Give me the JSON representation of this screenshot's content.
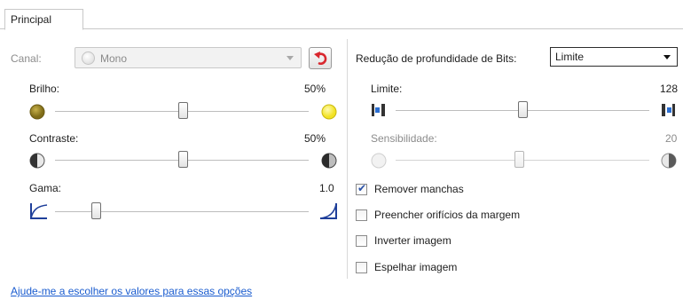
{
  "tab": {
    "label": "Principal"
  },
  "left": {
    "channel": {
      "label": "Canal:",
      "value": "Mono"
    },
    "brightness": {
      "label": "Brilho:",
      "value_text": "50%",
      "position": 0.5
    },
    "contrast": {
      "label": "Contraste:",
      "value_text": "50%",
      "position": 0.5
    },
    "gamma": {
      "label": "Gama:",
      "value_text": "1.0",
      "position": 0.18
    }
  },
  "right": {
    "bit_depth": {
      "label": "Redução de profundidade de Bits:",
      "value": "Limite"
    },
    "threshold": {
      "label": "Limite:",
      "value_text": "128",
      "position": 0.5
    },
    "sensitivity": {
      "label": "Sensibilidade:",
      "value_text": "20",
      "position": 0.5
    },
    "options": [
      {
        "label": "Remover manchas",
        "checked": true
      },
      {
        "label": "Preencher orifícios da margem",
        "checked": false
      },
      {
        "label": "Inverter imagem",
        "checked": false
      },
      {
        "label": "Espelhar imagem",
        "checked": false
      }
    ]
  },
  "help_link": "Ajude-me a escolher os valores para essas opções",
  "colors": {
    "link": "#1a5ccf",
    "reset_arrow": "#d9272e",
    "checkmark": "#2a52a8"
  },
  "icons": {
    "reset": "reset-arrow-icon",
    "brightness_low": "dark-circle-icon",
    "brightness_high": "bright-circle-icon",
    "contrast": "half-circle-icon",
    "gamma_low": "gamma-curve-low-icon",
    "gamma_high": "gamma-curve-high-icon",
    "threshold_low": "threshold-left-icon",
    "threshold_high": "threshold-right-icon"
  }
}
